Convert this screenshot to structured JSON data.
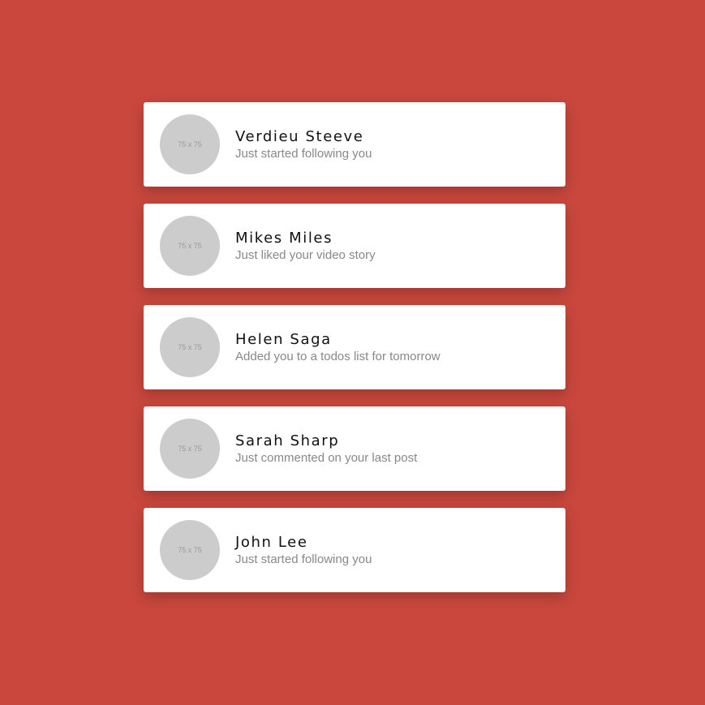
{
  "colors": {
    "background": "#c9473d",
    "card": "#ffffff",
    "avatar_placeholder": "#cccccc",
    "name_text": "#111111",
    "message_text": "#888888"
  },
  "notifications": [
    {
      "avatar_label": "75 x 75",
      "name": "Verdieu Steeve",
      "message": "Just started following you"
    },
    {
      "avatar_label": "75 x 75",
      "name": "Mikes Miles",
      "message": "Just liked your video story"
    },
    {
      "avatar_label": "75 x 75",
      "name": "Helen Saga",
      "message": "Added you to a todos list for tomorrow"
    },
    {
      "avatar_label": "75 x 75",
      "name": "Sarah Sharp",
      "message": "Just commented on your last post"
    },
    {
      "avatar_label": "75 x 75",
      "name": "John Lee",
      "message": "Just started following you"
    }
  ]
}
